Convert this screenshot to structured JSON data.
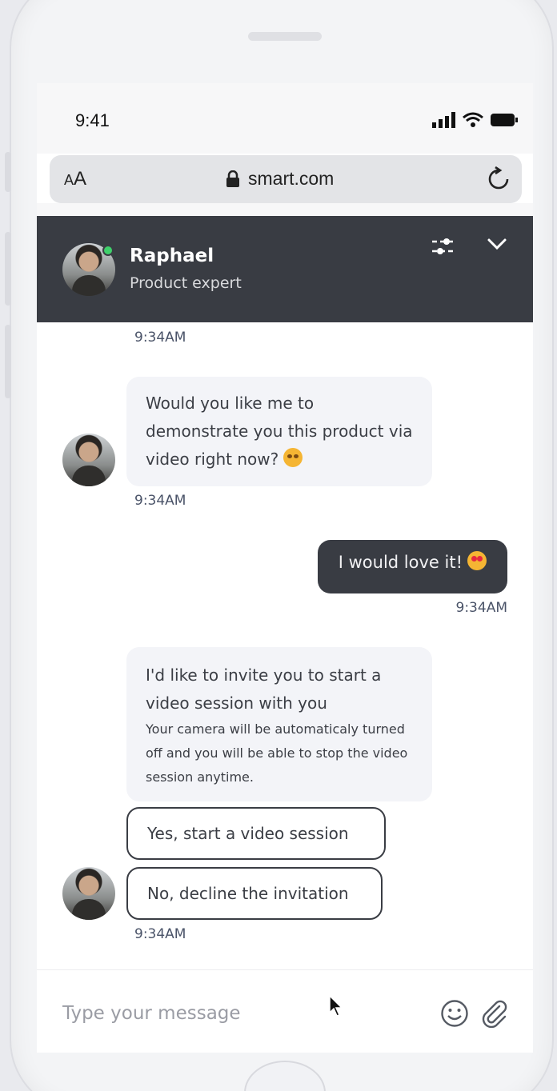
{
  "status_bar": {
    "time": "9:41"
  },
  "browser": {
    "aa_label": "AA",
    "url": "smart.com"
  },
  "chat_header": {
    "agent_name": "Raphael",
    "agent_role": "Product expert"
  },
  "messages": [
    {
      "timestamp": "9:34AM"
    },
    {
      "text": "Would you like me to demonstrate you this product via video right now?",
      "timestamp": "9:34AM"
    },
    {
      "text": "I would love it!",
      "timestamp": "9:34AM"
    },
    {
      "text": "I'd like to invite you to start a video session with you",
      "note": "Your camera will be automaticaly turned off and you will be able to stop the video session anytime.",
      "options": [
        "Yes, start a video session",
        "No, decline the invitation"
      ],
      "timestamp": "9:34AM"
    }
  ],
  "composer": {
    "placeholder": "Type your message"
  },
  "colors": {
    "header_bg": "#393c43",
    "online": "#3fd06b",
    "bubble_in": "#f3f4f8"
  }
}
